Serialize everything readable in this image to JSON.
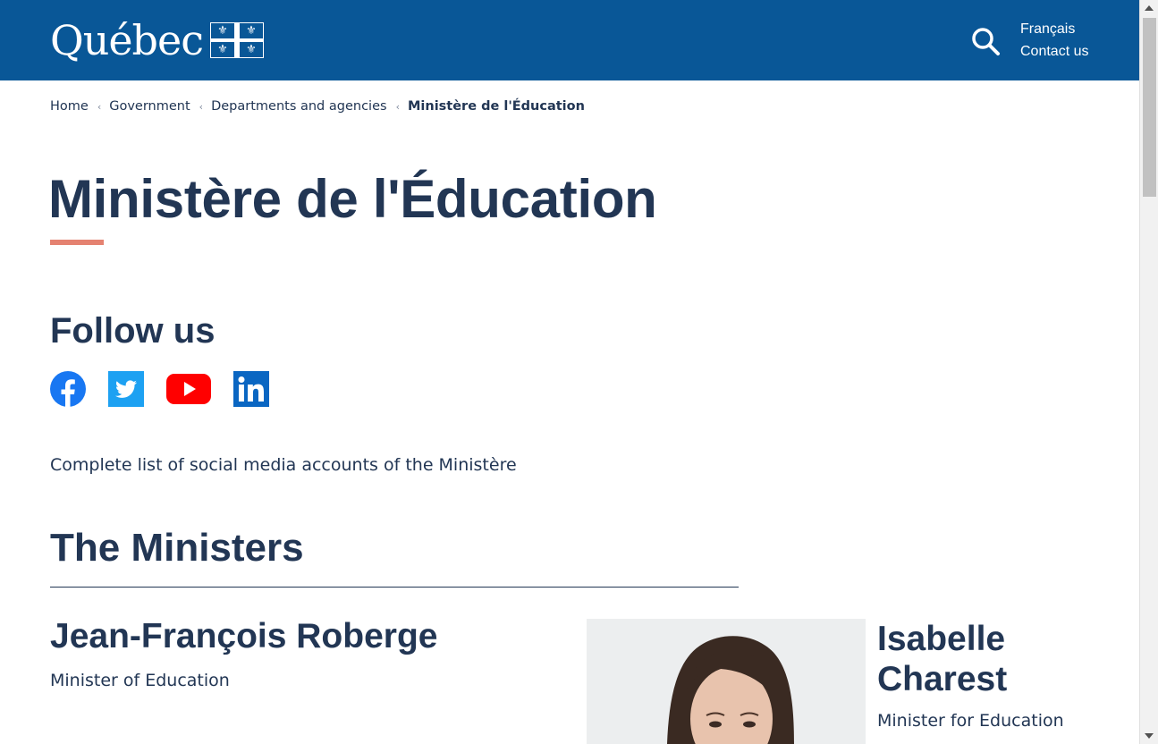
{
  "header": {
    "logo_text": "Québec",
    "logo_flag": "fleur-de-lis-flag",
    "search_icon": "search-icon",
    "lang_link": "Français",
    "contact_link": "Contact us",
    "background": "#095797"
  },
  "breadcrumb": {
    "items": [
      "Home",
      "Government",
      "Departments and agencies",
      "Ministère de l'Éducation"
    ]
  },
  "page": {
    "title": "Ministère de l'Éducation",
    "accent_color": "#e58271",
    "text_color": "#223654"
  },
  "follow": {
    "heading": "Follow us",
    "networks": [
      "facebook-icon",
      "twitter-icon",
      "youtube-icon",
      "linkedin-icon"
    ],
    "list_link": "Complete list of social media accounts of the Ministère"
  },
  "ministers": {
    "heading": "The Ministers",
    "items": [
      {
        "name": "Jean-François Roberge",
        "role": "Minister of Education"
      },
      {
        "name": "Isabelle Charest",
        "role": "Minister for Education"
      }
    ]
  }
}
